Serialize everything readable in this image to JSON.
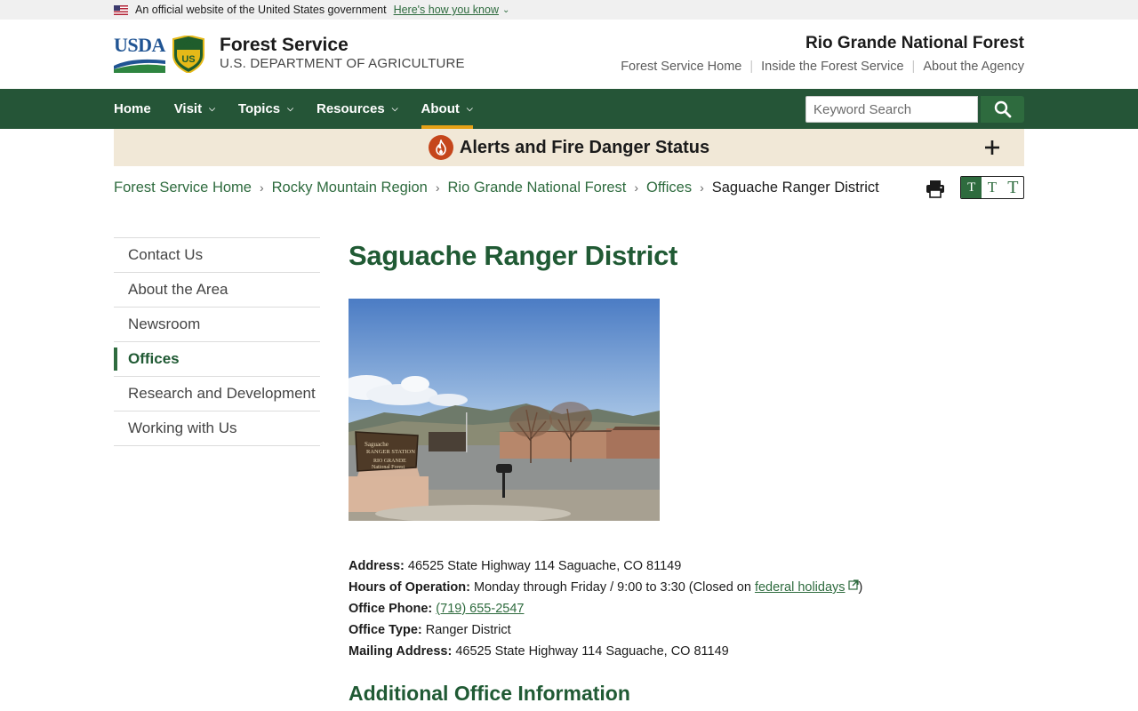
{
  "gov_banner": {
    "text": "An official website of the United States government",
    "link": "Here's how you know"
  },
  "header": {
    "usda_logo_text": "USDA",
    "agency_title": "Forest Service",
    "agency_dept": "U.S. DEPARTMENT OF AGRICULTURE",
    "forest_name": "Rio Grande National Forest",
    "top_links": [
      "Forest Service Home",
      "Inside the Forest Service",
      "About the Agency"
    ]
  },
  "nav": {
    "items": [
      {
        "label": "Home",
        "has_menu": false
      },
      {
        "label": "Visit",
        "has_menu": true
      },
      {
        "label": "Topics",
        "has_menu": true
      },
      {
        "label": "Resources",
        "has_menu": true
      },
      {
        "label": "About",
        "has_menu": true,
        "active": true
      }
    ],
    "search_placeholder": "Keyword Search"
  },
  "alert": {
    "title": "Alerts and Fire Danger Status"
  },
  "breadcrumb": {
    "items": [
      "Forest Service Home",
      "Rocky Mountain Region",
      "Rio Grande National Forest",
      "Offices"
    ],
    "current": "Saguache Ranger District"
  },
  "text_size": {
    "options": [
      "T",
      "T",
      "T"
    ],
    "selected": 0
  },
  "side_nav": {
    "items": [
      "Contact Us",
      "About the Area",
      "Newsroom",
      "Offices",
      "Research and Development",
      "Working with Us"
    ],
    "active": "Offices"
  },
  "main": {
    "title": "Saguache Ranger District",
    "photo_sign_lines": [
      "Saguache",
      "RANGER STATION",
      "RIO GRANDE",
      "National Forest"
    ],
    "info": {
      "address_label": "Address:",
      "address": "46525 State Highway 114 Saguache, CO 81149",
      "hours_label": "Hours of Operation:",
      "hours": "Monday through Friday / 9:00 to 3:30 (Closed on",
      "hours_link": "federal holidays",
      "hours_close": ")",
      "phone_label": "Office Phone:",
      "phone": "(719) 655-2547",
      "type_label": "Office Type:",
      "type": "Ranger District",
      "mailing_label": "Mailing Address:",
      "mailing": "46525 State Highway 114 Saguache, CO 81149"
    },
    "subheading": "Additional Office Information"
  },
  "colors": {
    "brand_green": "#255537",
    "link_green": "#2e6b3e",
    "nav_active_accent": "#e6a117",
    "alert_bg": "#f1e8d7",
    "fire_orange": "#c5461b"
  }
}
